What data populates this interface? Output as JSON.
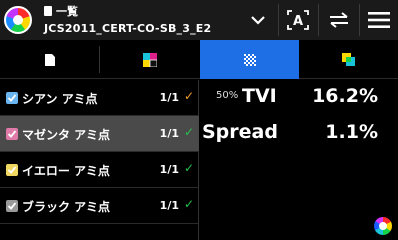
{
  "header": {
    "list_title": "一覧",
    "file_name": "JCS2011_CERT-CO-SB_3_E2"
  },
  "tabs": [
    {
      "name": "document",
      "active": false
    },
    {
      "name": "color-patches",
      "active": false
    },
    {
      "name": "halftone",
      "active": true
    },
    {
      "name": "overlay",
      "active": false
    }
  ],
  "rows": [
    {
      "label": "シアン アミ点",
      "count": "1/1",
      "status": "✓",
      "status_color": "#f0a030",
      "checkbox_color": "#6ab4f0",
      "selected": false
    },
    {
      "label": "マゼンタ アミ点",
      "count": "1/1",
      "status": "✓",
      "status_color": "#27c24c",
      "checkbox_color": "#e07aa8",
      "selected": true
    },
    {
      "label": "イエロー アミ点",
      "count": "1/1",
      "status": "✓",
      "status_color": "#27c24c",
      "checkbox_color": "#f0d860",
      "selected": false
    },
    {
      "label": "ブラック アミ点",
      "count": "1/1",
      "status": "✓",
      "status_color": "#27c24c",
      "checkbox_color": "#9a9a9a",
      "selected": false
    }
  ],
  "metrics": {
    "tvi_percent": "50%",
    "tvi_label": "TVI",
    "tvi_value": "16.2%",
    "spread_label": "Spread",
    "spread_value": "1.1%"
  },
  "colors": {
    "accent": "#1e6ee6",
    "ok": "#27c24c",
    "warn": "#f0a030"
  }
}
